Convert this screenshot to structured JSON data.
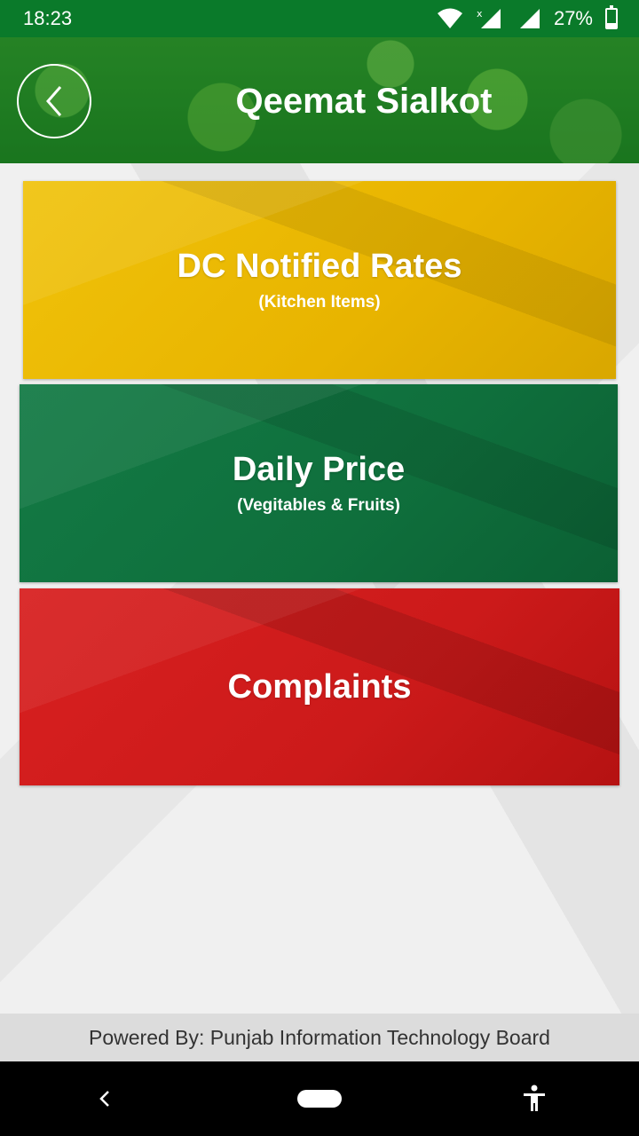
{
  "status_bar": {
    "time": "18:23",
    "battery_percent": "27%",
    "battery_level": 0.27,
    "icons": [
      "wifi-icon",
      "signal-icon",
      "battery-icon"
    ]
  },
  "header": {
    "title": "Qeemat Sialkot",
    "back_icon": "chevron-left-icon"
  },
  "tiles": [
    {
      "title": "DC Notified Rates",
      "subtitle": "(Kitchen Items)",
      "color": "#f0c20a"
    },
    {
      "title": "Daily Price",
      "subtitle": "(Vegitables & Fruits)",
      "color": "#137a45"
    },
    {
      "title": "Complaints",
      "subtitle": "",
      "color": "#d82020"
    }
  ],
  "footer": {
    "text": "Powered By: Punjab Information Technology Board"
  },
  "nav_bar": {
    "icons": [
      "back-icon",
      "home-icon",
      "accessibility-icon"
    ]
  },
  "colors": {
    "status_bar": "#0a7a2a",
    "footer_bg": "#dcdcdc"
  }
}
